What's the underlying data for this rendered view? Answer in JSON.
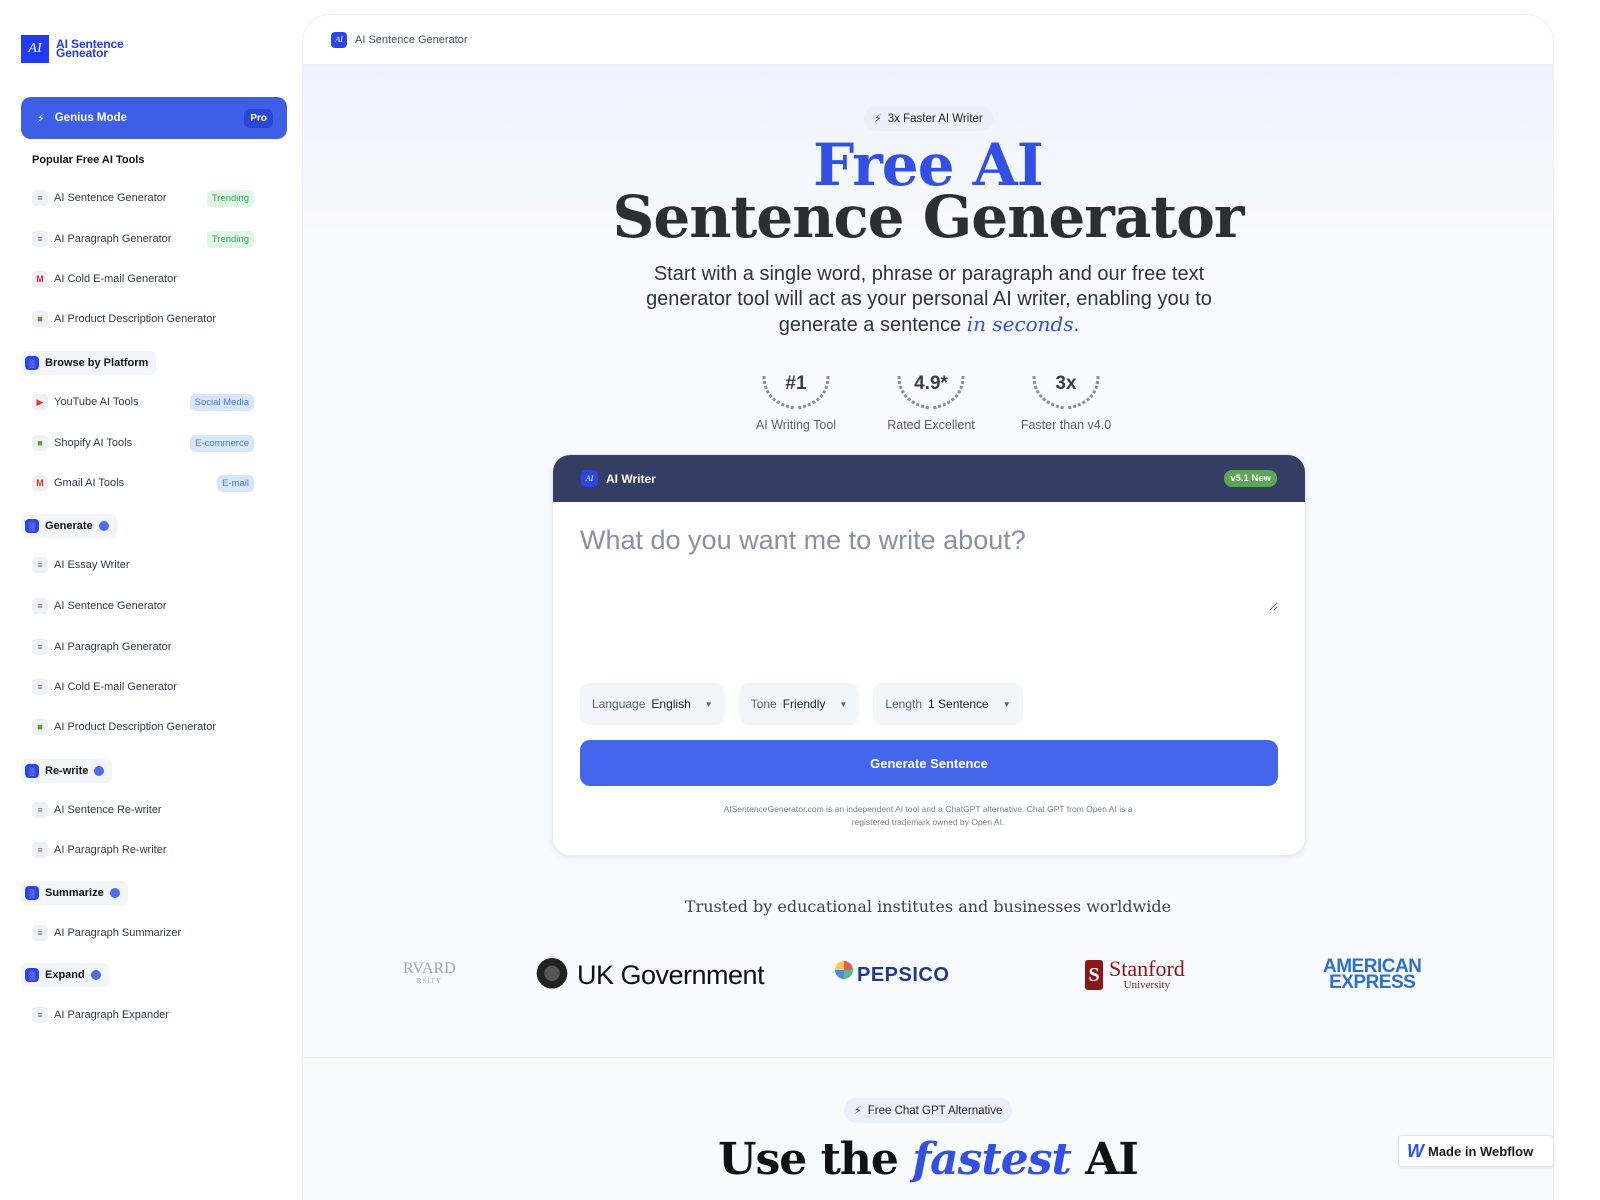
{
  "brand": {
    "logo_mark": "AI",
    "name_line1": "AI Sentence",
    "name_line2": "Geneator"
  },
  "sidebar": {
    "genius": {
      "label": "Genius Mode",
      "badge": "Pro",
      "icon": "bolt-icon"
    },
    "popular_title": "Popular Free AI Tools",
    "popular": [
      {
        "label": "AI Sentence Generator",
        "tag": "Trending",
        "icon": "lines-icon"
      },
      {
        "label": "AI Paragraph Generator",
        "tag": "Trending",
        "icon": "lines-icon"
      },
      {
        "label": "AI Cold E-mail Generator",
        "icon": "gmail-icon"
      },
      {
        "label": "AI Product Description Generator",
        "icon": "shopify-icon"
      }
    ],
    "platform_title": "Browse by Platform",
    "platform": [
      {
        "label": "YouTube AI Tools",
        "tag": "Social Media",
        "icon": "youtube-icon"
      },
      {
        "label": "Shopify AI Tools",
        "tag": "E-commerce",
        "icon": "shopify-icon"
      },
      {
        "label": "Gmail AI Tools",
        "tag": "E-mail",
        "icon": "gmail-icon"
      }
    ],
    "generate_title": "Generate",
    "generate": [
      {
        "label": "AI Essay Writer"
      },
      {
        "label": "AI Sentence Generator"
      },
      {
        "label": "AI Paragraph Generator"
      },
      {
        "label": "AI Cold E-mail Generator"
      },
      {
        "label": "AI Product Description Generator"
      }
    ],
    "rewrite_title": "Re-write",
    "rewrite": [
      {
        "label": "AI Sentence Re-writer"
      },
      {
        "label": "AI Paragraph Re-writer"
      }
    ],
    "summarize_title": "Summarize",
    "summarize": [
      {
        "label": "AI Paragraph Summarizer"
      }
    ],
    "expand_title": "Expand",
    "expand": [
      {
        "label": "AI Paragraph Expander"
      }
    ]
  },
  "topbar": {
    "icon_text": "AI",
    "title": "AI Sentence Generator"
  },
  "hero": {
    "pill": "3x Faster AI Writer",
    "title_line1": "Free AI",
    "title_line2": "Sentence Generator",
    "subtitle_pre": "Start with a single word, phrase or paragraph and our free text generator tool will act as your personal AI writer, enabling you to generate a sentence ",
    "subtitle_em": "in seconds",
    "subtitle_post": ".",
    "stats": [
      {
        "value": "#1",
        "caption": "AI Writing Tool"
      },
      {
        "value": "4.9*",
        "caption": "Rated Excellent"
      },
      {
        "value": "3x",
        "caption": "Faster than v4.0"
      }
    ]
  },
  "writer": {
    "header_title": "AI Writer",
    "icon_text": "AI",
    "version_badge": "v5.1 New",
    "prompt_placeholder": "What do you want me to write about?",
    "prompt_value": "",
    "options": [
      {
        "key": "Language",
        "value": "English"
      },
      {
        "key": "Tone",
        "value": "Friendly"
      },
      {
        "key": "Length",
        "value": "1 Sentence"
      }
    ],
    "generate_label": "Generate Sentence",
    "disclaimer": "AISentenceGenerator.com is an independent AI tool and a ChatGPT alternative. Chat GPT from Open AI is a registered trademark owned by Open AI."
  },
  "trusted": {
    "heading": "Trusted by educational institutes and businesses worldwide",
    "logos": {
      "harvard": "RVARD",
      "harvard_sub": "RSITY",
      "ukgov": "UK Government",
      "pepsico": "PEPSICO",
      "stanford": "Stanford",
      "stanford_sub": "University",
      "amex_1": "AMERICAN",
      "amex_2": "EXPRESS"
    }
  },
  "section2": {
    "pill": "Free Chat GPT Alternative",
    "title_pre": "Use the ",
    "title_em": "fastest",
    "title_post": " AI"
  },
  "webflow_badge": "Made in Webflow"
}
